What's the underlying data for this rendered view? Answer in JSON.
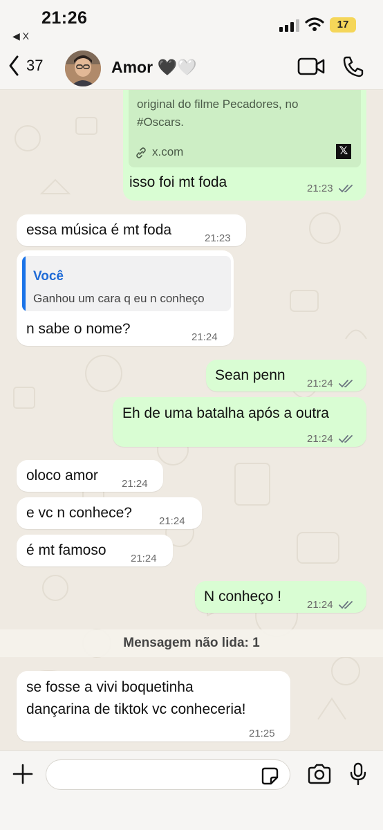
{
  "status_bar": {
    "time": "21:26",
    "back_app": "◀ X",
    "battery": "17"
  },
  "header": {
    "back_count": "37",
    "contact_name": "Amor 🖤🤍",
    "colors": {
      "bar": "#f6f5f3"
    }
  },
  "messages": [
    {
      "type": "link_preview",
      "direction": "out",
      "preview_description": "original do filme Pecadores, no #Oscars.",
      "preview_description_partial": "...",
      "preview_domain": "x.com",
      "text": "isso foi mt foda",
      "time": "21:23",
      "read": true
    },
    {
      "direction": "in",
      "text": "essa música é mt foda",
      "time": "21:23"
    },
    {
      "direction": "in",
      "reply_to_author": "Você",
      "reply_to_text": "Ganhou um cara q eu n conheço",
      "text": "n sabe o nome?",
      "time": "21:24"
    },
    {
      "direction": "out",
      "text": "Sean penn",
      "time": "21:24",
      "read": true
    },
    {
      "direction": "out",
      "text": "Eh de uma batalha após a outra",
      "time": "21:24",
      "read": true
    },
    {
      "direction": "in",
      "text": "oloco amor",
      "time": "21:24"
    },
    {
      "direction": "in",
      "text": "e vc n conhece?",
      "time": "21:24"
    },
    {
      "direction": "in",
      "text": "é mt famoso",
      "time": "21:24"
    },
    {
      "direction": "out",
      "text": "N conheço !",
      "time": "21:24",
      "read": true
    },
    {
      "direction": "in",
      "line1": "se fosse a vivi boquetinha",
      "line2": "dançarina de tiktok vc conheceria!",
      "time": "21:25"
    }
  ],
  "unread_divider": "Mensagem não lida: 1",
  "composer": {
    "value": ""
  },
  "colors": {
    "outgoing_bubble": "#d9fdd3",
    "incoming_bubble": "#ffffff",
    "tick_color": "#6b7580",
    "quote_accent": "#1a73e8",
    "battery": "#f5d659"
  }
}
